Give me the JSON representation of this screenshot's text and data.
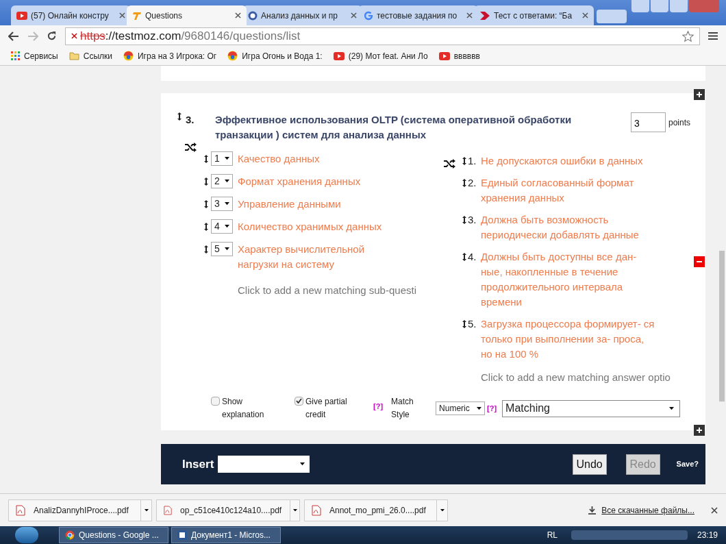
{
  "browser": {
    "tabs": [
      {
        "title": "(57) Онлайн констру",
        "selected": false
      },
      {
        "title": "Questions",
        "selected": true
      },
      {
        "title": "Анализ данных и пр",
        "selected": false
      },
      {
        "title": "тестовые задания по",
        "selected": false
      },
      {
        "title": "Тест с ответами: “Ба",
        "selected": false
      }
    ],
    "address": {
      "insecure_scheme": "https",
      "rest": "://testmoz.com",
      "path": "/9680146/questions/list"
    },
    "bookmarks": [
      {
        "label": "Сервисы"
      },
      {
        "label": "Ссылки"
      },
      {
        "label": "Игра на 3 Игрока: Ог"
      },
      {
        "label": "Игра Огонь и Вода 1:"
      },
      {
        "label": "(29) Мот feat. Ани Ло"
      },
      {
        "label": "вввввв"
      }
    ]
  },
  "question": {
    "number": "3.",
    "title": "Эффективное использования  OLTP (система оперативной обработки транзакции ) систем для анализа данных",
    "points": "3",
    "points_label": "points",
    "sub_questions": [
      {
        "match": "1",
        "text": "Качество данных"
      },
      {
        "match": "2",
        "text": "Формат хранения данных"
      },
      {
        "match": "3",
        "text": "Управление данными"
      },
      {
        "match": "4",
        "text": "Количество хранимых данных"
      },
      {
        "match": "5",
        "text": "Характер вычислительной нагрузки на систему"
      }
    ],
    "add_sub_question": "Click to add a new matching sub-questi",
    "answers": [
      {
        "number": "1.",
        "text": "Не допускаются ошибки в данных"
      },
      {
        "number": "2.",
        "text": "Единый согласованный формат хранения данных"
      },
      {
        "number": "3.",
        "text": "Должна быть возможность периодически добавлять данные"
      },
      {
        "number": "4.",
        "text": "Должны быть доступны все дан- ные, накопленные в течение продолжительного интервала времени"
      },
      {
        "number": "5.",
        "text": "Загрузка процессора формирует- ся только при выполнении за- проса, но на 100 %"
      }
    ],
    "add_answer": "Click to add a new matching answer optio",
    "options": {
      "show_explanation": {
        "label": "Show explanation",
        "checked": false
      },
      "partial_credit": {
        "label": "Give partial credit",
        "checked": true
      },
      "help_1": "[?]",
      "match_style_label": "Match Style",
      "match_style": "Numeric",
      "help_2": "[?]",
      "question_type": "Matching"
    }
  },
  "toolbar": {
    "insert_label": "Insert",
    "undo": {
      "label": "Undo",
      "disabled": false
    },
    "redo": {
      "label": "Redo",
      "disabled": true
    },
    "save": "Save?"
  },
  "downloads": {
    "files": [
      "AnalizDannyhIProce....pdf",
      "op_c51ce410c124a10....pdf",
      "Annot_mo_pmi_26.0....pdf"
    ],
    "show_all": "Все скачанные файлы..."
  },
  "taskbar": {
    "windows": [
      {
        "title": "Questions - Google ..."
      },
      {
        "title": "Документ1 - Micros..."
      }
    ],
    "language": "RL",
    "time": "23:19"
  }
}
